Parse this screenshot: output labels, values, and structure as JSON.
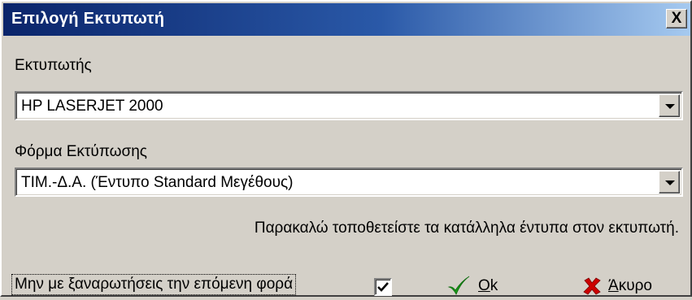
{
  "window": {
    "title": "Επιλογή Εκτυπωτή",
    "close_label": "X"
  },
  "printer": {
    "label": "Εκτυπωτής",
    "value": "HP LASERJET 2000"
  },
  "form": {
    "label": "Φόρμα Εκτύπωσης",
    "value": "ΤΙΜ.-Δ.Α. (Έντυπο Standard Μεγέθους)"
  },
  "info_text": "Παρακαλώ τοποθετείστε τα κατάλληλα έντυπα στον εκτυπωτή.",
  "dont_ask": {
    "label": "Μην με ξαναρωτήσεις την επόμενη φορά",
    "checked": true
  },
  "buttons": {
    "ok": {
      "mnemonic": "O",
      "rest": "k",
      "icon": "check-icon",
      "icon_color": "#1a9a1a"
    },
    "cancel": {
      "mnemonic": "Ά",
      "rest": "κυρο",
      "icon": "cross-icon",
      "icon_color": "#cc0000"
    }
  },
  "colors": {
    "title_start": "#0a246a",
    "title_end": "#a6caf0",
    "face": "#d4d0c8"
  }
}
